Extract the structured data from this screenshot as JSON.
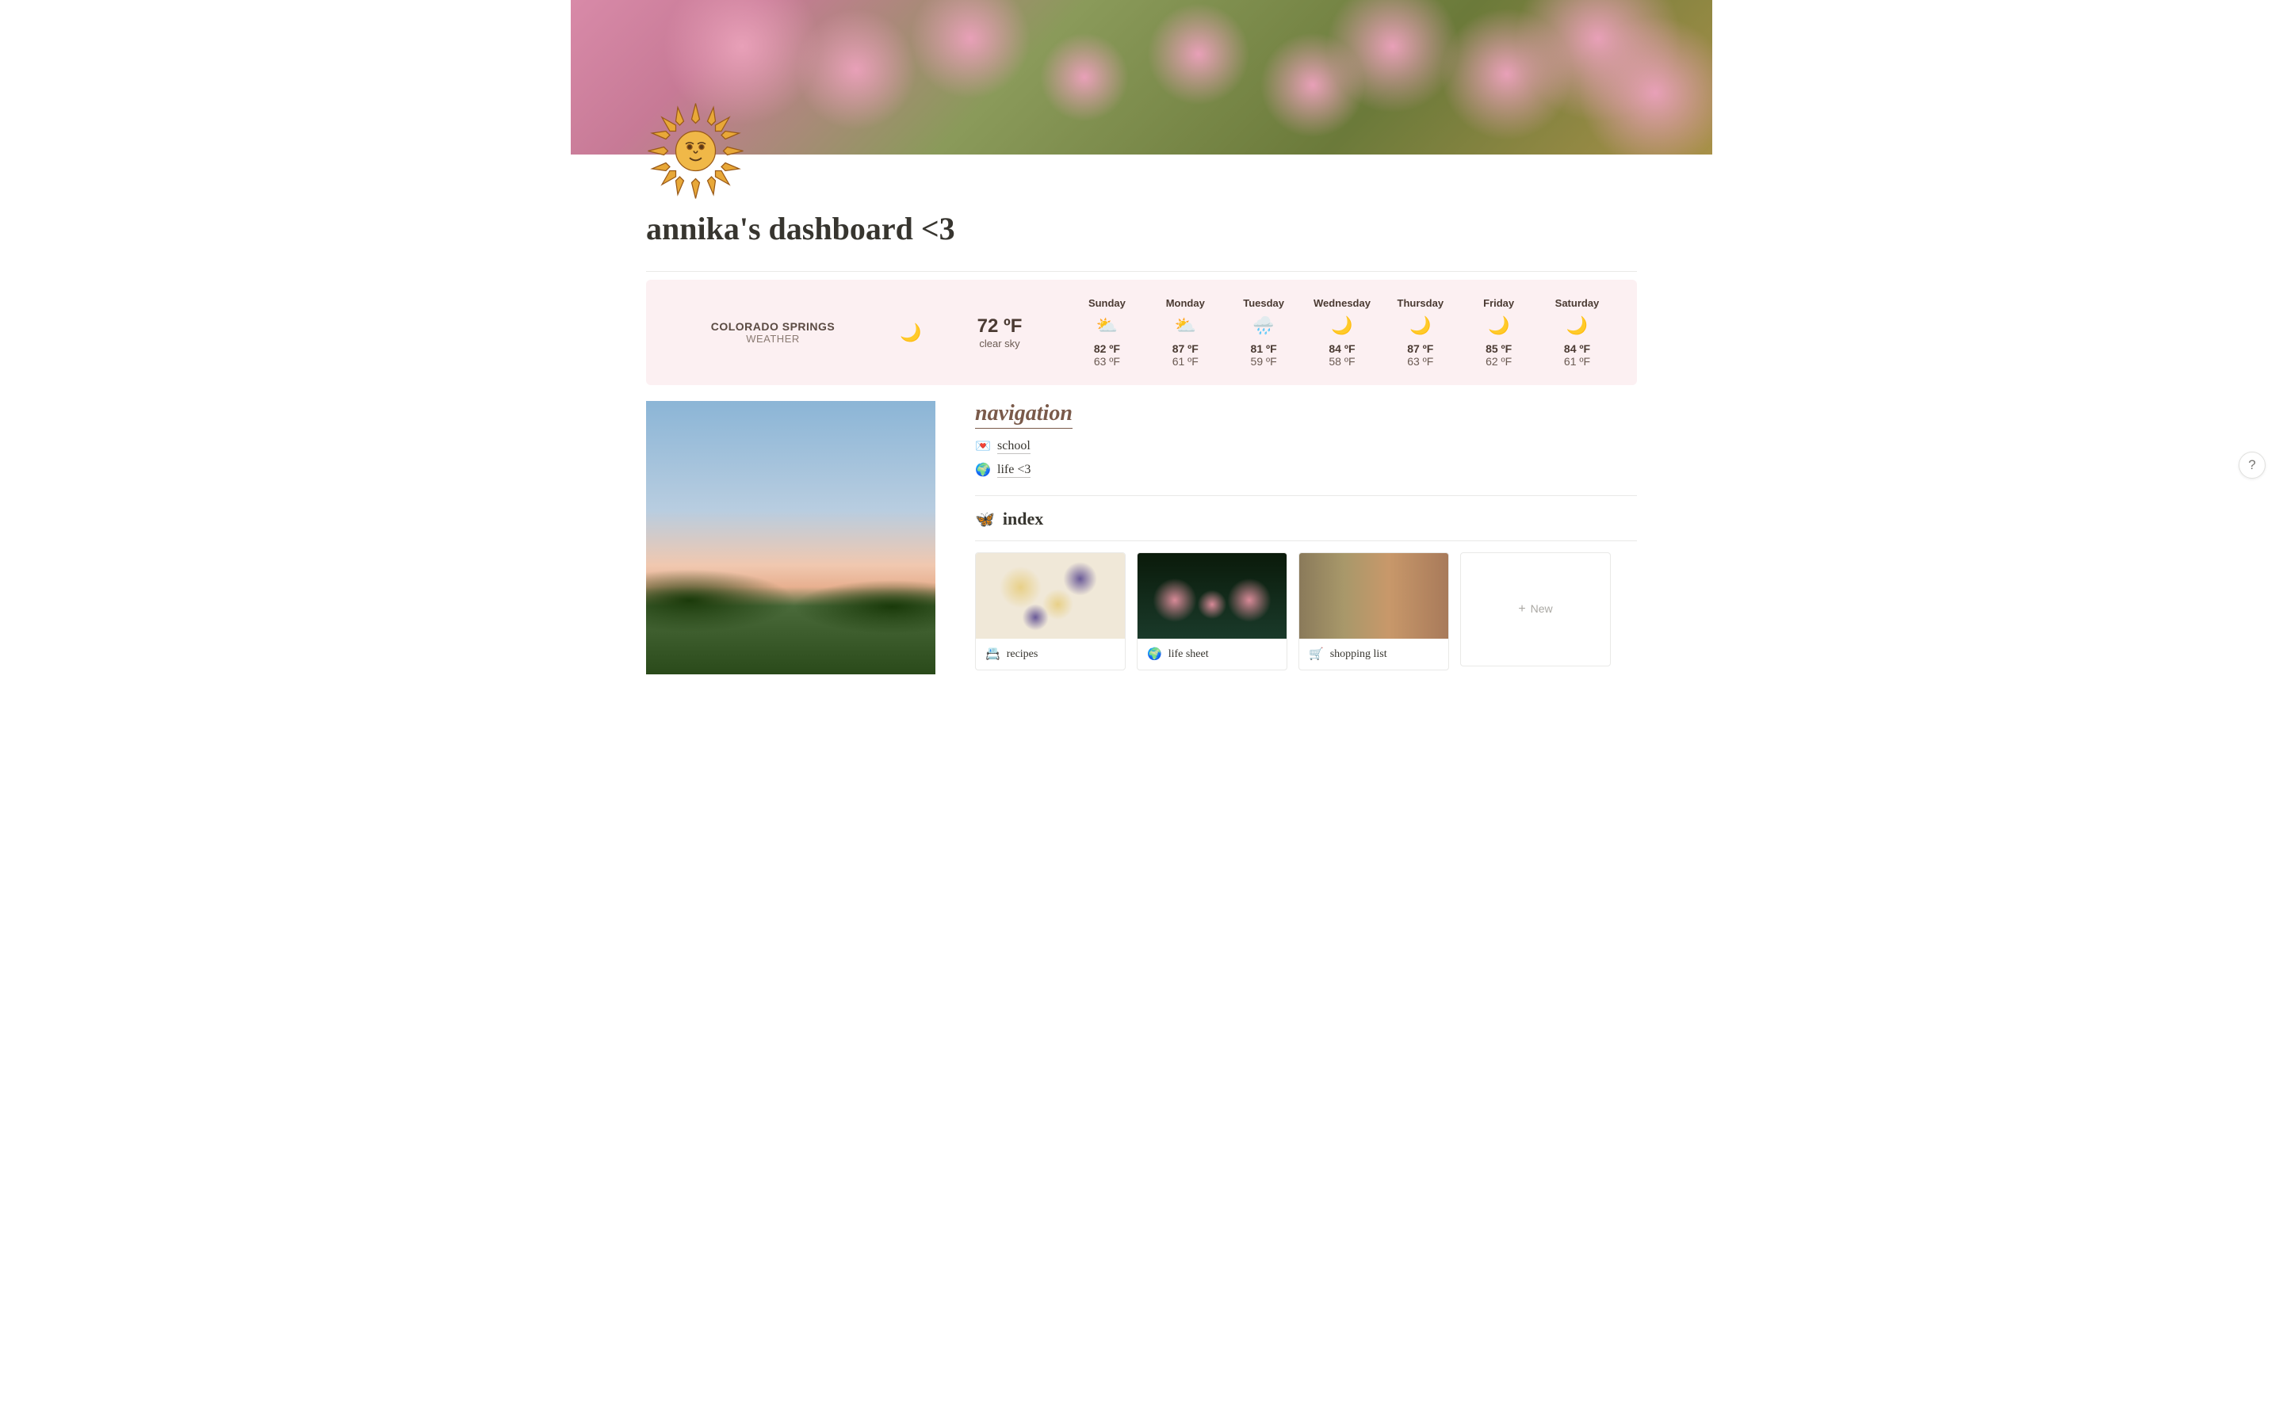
{
  "page": {
    "title": "annika's dashboard <3"
  },
  "weather": {
    "city": "COLORADO SPRINGS",
    "label": "WEATHER",
    "now_icon": "🌙",
    "now_temp": "72 ºF",
    "now_cond": "clear sky",
    "days": [
      {
        "name": "Sunday",
        "icon": "⛅",
        "hi": "82 ºF",
        "lo": "63 ºF"
      },
      {
        "name": "Monday",
        "icon": "⛅",
        "hi": "87 ºF",
        "lo": "61 ºF"
      },
      {
        "name": "Tuesday",
        "icon": "🌧️",
        "hi": "81 ºF",
        "lo": "59 ºF"
      },
      {
        "name": "Wednesday",
        "icon": "🌙",
        "hi": "84 ºF",
        "lo": "58 ºF"
      },
      {
        "name": "Thursday",
        "icon": "🌙",
        "hi": "87 ºF",
        "lo": "63 ºF"
      },
      {
        "name": "Friday",
        "icon": "🌙",
        "hi": "85 ºF",
        "lo": "62 ºF"
      },
      {
        "name": "Saturday",
        "icon": "🌙",
        "hi": "84 ºF",
        "lo": "61 ºF"
      }
    ]
  },
  "navigation": {
    "heading": "navigation",
    "links": [
      {
        "icon": "💌",
        "label": "school"
      },
      {
        "icon": "🌍",
        "label": "life <3"
      }
    ]
  },
  "index": {
    "icon": "🦋",
    "heading": "index",
    "cards": [
      {
        "icon": "📇",
        "label": "recipes"
      },
      {
        "icon": "🌍",
        "label": "life sheet"
      },
      {
        "icon": "🛒",
        "label": "shopping list"
      }
    ],
    "new_label": "New"
  },
  "help": {
    "label": "?"
  }
}
